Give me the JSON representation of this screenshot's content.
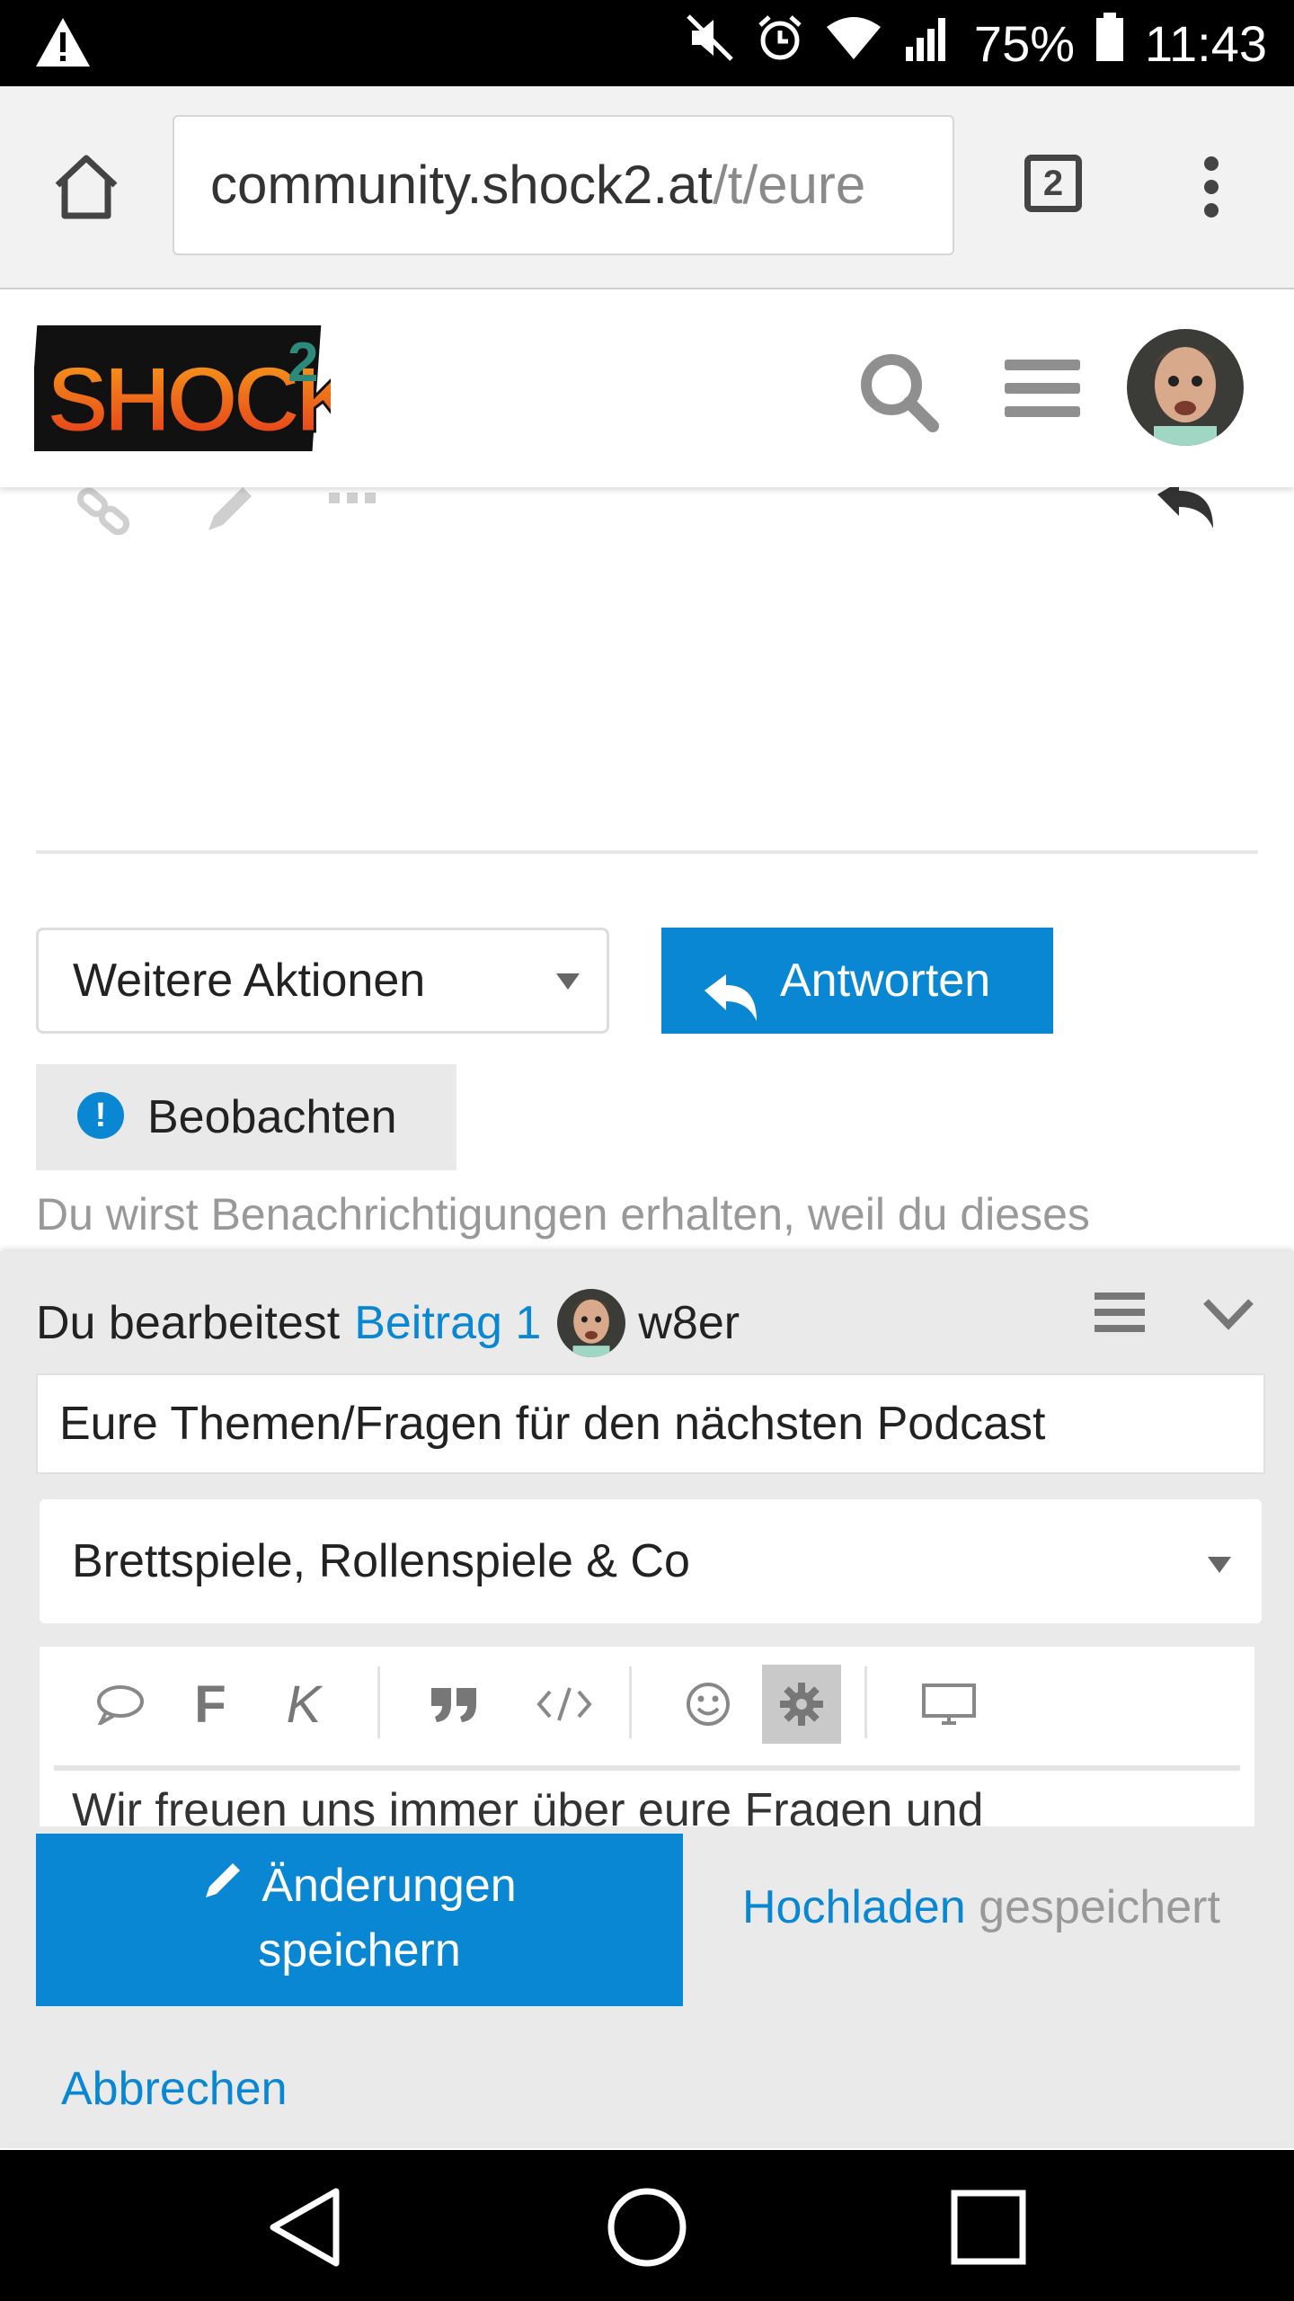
{
  "status_bar": {
    "battery": "75%",
    "time": "11:43",
    "icons": [
      "warning-icon",
      "mute-icon",
      "alarm-icon",
      "wifi-icon",
      "signal-icon",
      "battery-icon"
    ]
  },
  "browser": {
    "url_domain": "community.shock2.at",
    "url_path": "/t/eure",
    "tab_count": "2"
  },
  "site": {
    "logo_text": "SHOCK",
    "logo_sup": "2"
  },
  "topic": {
    "more_actions_label": "Weitere Aktionen",
    "reply_label": "Antworten",
    "watch_label": "Beobachten",
    "notification_text": "Du wirst Benachrichtigungen erhalten, weil du dieses"
  },
  "composer": {
    "editing_prefix": "Du bearbeitest",
    "post_link": "Beitrag 1",
    "username": "w8er",
    "title_value": "Eure Themen/Fragen für den nächsten Podcast",
    "category": "Brettspiele, Rollenspiele & Co",
    "toolbar": {
      "bold": "F",
      "italic": "K"
    },
    "body_preview": "Wir freuen uns immer über eure Fragen und",
    "save_label_line1": "Änderungen",
    "save_label_line2": "speichern",
    "upload_label": "Hochladen",
    "saved_label": "gespeichert",
    "cancel_label": "Abbrechen"
  },
  "colors": {
    "accent": "#0a87d2",
    "composer_bg": "#eaeaea"
  }
}
